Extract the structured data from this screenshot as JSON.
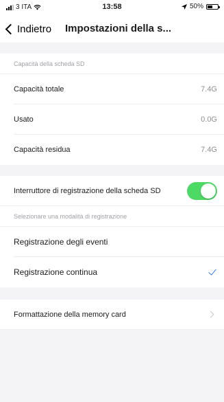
{
  "status_bar": {
    "carrier": "3 ITA",
    "time": "13:58",
    "battery_percent": "50%",
    "battery_level": 0.5
  },
  "nav": {
    "back_label": "Indietro",
    "title": "Impostazioni della s..."
  },
  "sections": {
    "capacity": {
      "header": "Capacità della scheda SD",
      "rows": [
        {
          "label": "Capacità totale",
          "value": "7.4G"
        },
        {
          "label": "Usato",
          "value": "0.0G"
        },
        {
          "label": "Capacità residua",
          "value": "7.4G"
        }
      ]
    },
    "recording_switch": {
      "label": "Interruttore di registrazione della scheda SD",
      "enabled": true
    },
    "recording_mode": {
      "header": "Selezionare una modalità di registrazione",
      "options": [
        {
          "label": "Registrazione degli eventi",
          "selected": false
        },
        {
          "label": "Registrazione continua",
          "selected": true
        }
      ]
    },
    "format": {
      "label": "Formattazione della memory card"
    }
  },
  "colors": {
    "toggle_on": "#4cd964",
    "checkmark": "#3478f6",
    "background": "#f4f4f6"
  }
}
